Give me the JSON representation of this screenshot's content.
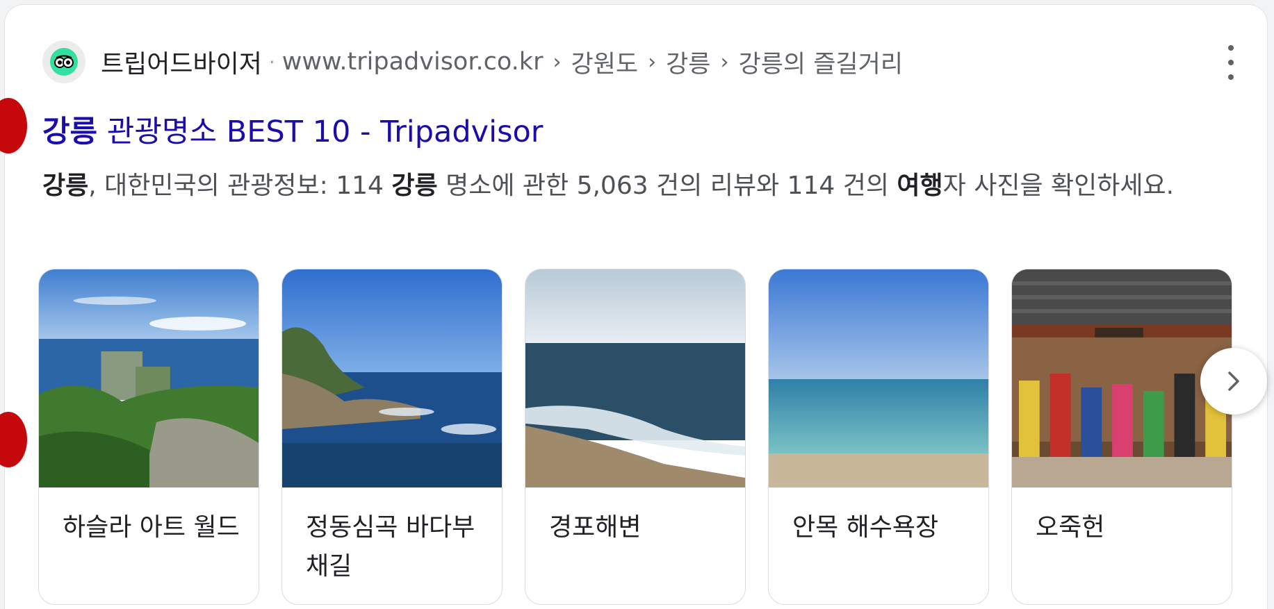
{
  "result": {
    "site_name": "트립어드바이저",
    "breadcrumb": [
      "www.tripadvisor.co.kr",
      "강원도",
      "강릉",
      "강릉의 즐길거리"
    ],
    "title_bold": "강릉",
    "title_rest": " 관광명소 BEST 10 - Tripadvisor",
    "snippet": {
      "p1": "강릉",
      "p2": ", 대한민국의 관광정보: 114 ",
      "p3": "강릉",
      "p4": " 명소에 관한 5,063 건의 리뷰와 114 건의 ",
      "p5": "여행",
      "p6": "자 사진을 확인하세요."
    }
  },
  "attractions": [
    {
      "name": "하슬라 아트 월드",
      "image": "hillside-resort-over-sea-photo"
    },
    {
      "name": "정동심곡 바다부채길",
      "image": "rocky-coast-blue-sea-photo"
    },
    {
      "name": "경포해변",
      "image": "beach-waves-photo"
    },
    {
      "name": "안목 해수욕장",
      "image": "calm-sea-horizon-photo"
    },
    {
      "name": "오죽헌",
      "image": "traditional-house-performers-photo"
    }
  ],
  "icons": {
    "favicon": "tripadvisor-owl-icon",
    "more": "more-vert-icon",
    "next": "chevron-right-icon"
  },
  "colors": {
    "title_link": "#1a0dab",
    "tripadvisor_green": "#34e0a1"
  }
}
